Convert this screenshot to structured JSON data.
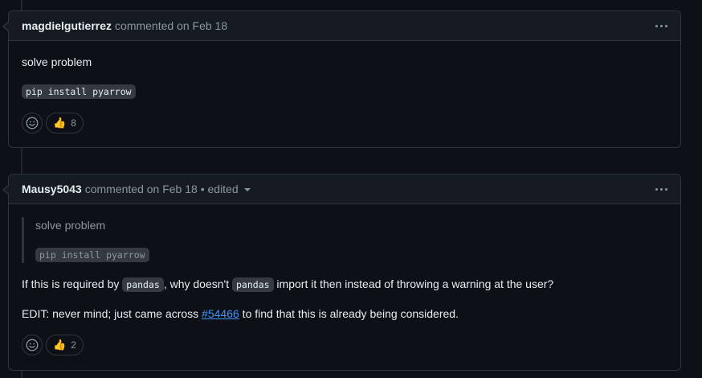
{
  "comments": [
    {
      "author": "magdielgutierrez",
      "meta": "commented on Feb 18",
      "body_text": "solve problem",
      "code": "pip install pyarrow",
      "reaction_count": "8",
      "reaction_emoji": "👍"
    },
    {
      "author": "Mausy5043",
      "meta": "commented on Feb 18",
      "edited_label": "• edited",
      "quote_text": "solve problem",
      "quote_code": "pip install pyarrow",
      "line1_a": "If this is required by ",
      "line1_code1": "pandas",
      "line1_b": ", why doesn't ",
      "line1_code2": "pandas",
      "line1_c": " import it then instead of throwing a warning at the user?",
      "line2_a": "EDIT: never mind; just came across ",
      "line2_link": "#54466",
      "line2_b": " to find that this is already being considered.",
      "reaction_count": "2",
      "reaction_emoji": "👍"
    }
  ],
  "colors": {
    "background": "#0d1117",
    "header_bg": "#161b22",
    "border": "#30363d",
    "link": "#4493f8",
    "muted": "#8d96a0"
  },
  "icons": [
    "kebab-horizontal-icon",
    "smiley-icon",
    "thumbs-up-icon",
    "caret-down-icon"
  ]
}
